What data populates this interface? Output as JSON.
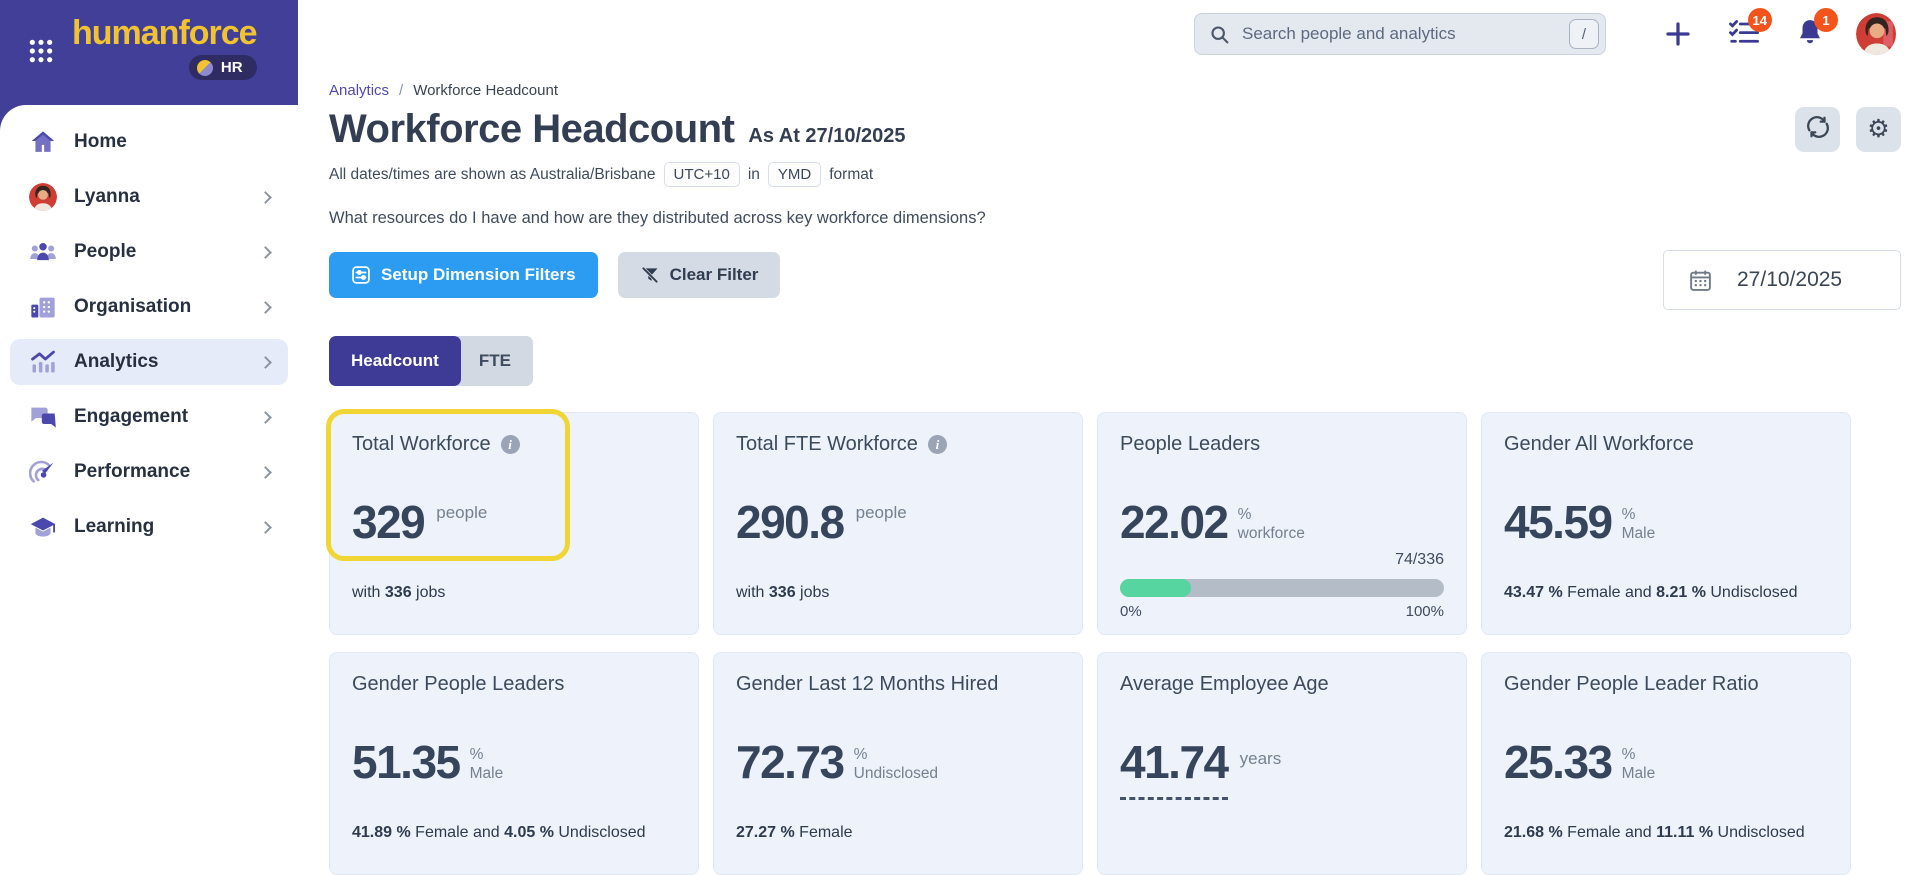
{
  "brand": {
    "logo_text": "humanforce",
    "badge": "HR"
  },
  "sidebar": {
    "items": [
      {
        "label": "Home"
      },
      {
        "label": "Lyanna"
      },
      {
        "label": "People"
      },
      {
        "label": "Organisation"
      },
      {
        "label": "Analytics"
      },
      {
        "label": "Engagement"
      },
      {
        "label": "Performance"
      },
      {
        "label": "Learning"
      }
    ],
    "active_item": "Analytics"
  },
  "topbar": {
    "search_placeholder": "Search people and analytics",
    "shortcut_key": "/",
    "tasks_badge": "14",
    "notifications_badge": "1"
  },
  "breadcrumb": {
    "parent": "Analytics",
    "separator": "/",
    "current": "Workforce Headcount"
  },
  "header": {
    "title": "Workforce Headcount",
    "as_at": "As At 27/10/2025",
    "tz_prefix": "All dates/times are shown as Australia/Brisbane",
    "tz_chip": "UTC+10",
    "tz_mid": "in",
    "format_chip": "YMD",
    "tz_suffix": "format",
    "question": "What resources do I have and how are they distributed across key workforce dimensions?"
  },
  "actions": {
    "setup_filters": "Setup Dimension Filters",
    "clear_filter": "Clear Filter",
    "date_value": "27/10/2025"
  },
  "tabs": {
    "headcount": "Headcount",
    "fte": "FTE",
    "active": "Headcount"
  },
  "cards": {
    "total_workforce": {
      "title": "Total Workforce",
      "value": "329",
      "unit": "people",
      "foot_pre": "with ",
      "foot_num": "336",
      "foot_post": " jobs",
      "highlighted": true
    },
    "total_fte": {
      "title": "Total FTE Workforce",
      "value": "290.8",
      "unit": "people",
      "foot_pre": "with ",
      "foot_num": "336",
      "foot_post": " jobs"
    },
    "people_leaders": {
      "title": "People Leaders",
      "value": "22.02",
      "unit_top": "%",
      "unit_bottom": "workforce",
      "ratio": "74/336",
      "progress_pct": "22.02",
      "scale_min": "0%",
      "scale_max": "100%"
    },
    "gender_all": {
      "title": "Gender All Workforce",
      "value": "45.59",
      "unit_top": "%",
      "unit_bottom": "Male",
      "f1": "43.47 %",
      "f2": " Female and ",
      "f3": "8.21 %",
      "f4": " Undisclosed"
    },
    "gender_leaders": {
      "title": "Gender People Leaders",
      "value": "51.35",
      "unit_top": "%",
      "unit_bottom": "Male",
      "f1": "41.89 %",
      "f2": " Female and ",
      "f3": "4.05 %",
      "f4": " Undisclosed"
    },
    "gender_hired": {
      "title": "Gender Last 12 Months Hired",
      "value": "72.73",
      "unit_top": "%",
      "unit_bottom": "Undisclosed",
      "f1": "27.27 %",
      "f2": " Female"
    },
    "avg_age": {
      "title": "Average Employee Age",
      "value": "41.74",
      "unit": "years"
    },
    "leader_ratio": {
      "title": "Gender People Leader Ratio",
      "value": "25.33",
      "unit_top": "%",
      "unit_bottom": "Male",
      "f1": "21.68 %",
      "f2": " Female and ",
      "f3": "11.11 %",
      "f4": " Undisclosed"
    }
  },
  "colors": {
    "brand_purple": "#423f99",
    "logo_yellow": "#f2c330",
    "badge_orange": "#f2541c",
    "primary_blue": "#2c9cf2",
    "active_tab": "#3e3b97",
    "progress_green": "#56d5a0",
    "highlight_yellow": "#f1d534",
    "card_bg": "#edf2fb"
  }
}
